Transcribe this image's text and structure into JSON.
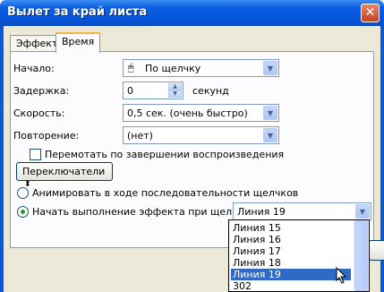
{
  "window": {
    "title": "Вылет за край листа",
    "close_icon": "close-icon"
  },
  "tabs": [
    {
      "label": "Эффект"
    },
    {
      "label": "Время"
    }
  ],
  "form": {
    "start_label": "Начало:",
    "start_value": "По щелчку",
    "delay_label": "Задержка:",
    "delay_value": "0",
    "delay_unit": "секунд",
    "speed_label": "Скорость:",
    "speed_value": "0,5 сек. (очень быстро)",
    "repeat_label": "Повторение:",
    "repeat_value": "(нет)",
    "rewind_label": "Перемотать по завершении воспроизведения",
    "triggers_label": "Переключатели",
    "animate_seq_label": "Анимировать в ходе последовательности щелчков",
    "start_on_click_label": "Начать выполнение эффекта при щелчке",
    "trigger_select_value": "Линия 19"
  },
  "dropdown": {
    "items": [
      "Линия 15",
      "Линия 16",
      "Линия 17",
      "Линия 18",
      "Линия 19",
      "302"
    ],
    "selected": "Линия 19"
  }
}
